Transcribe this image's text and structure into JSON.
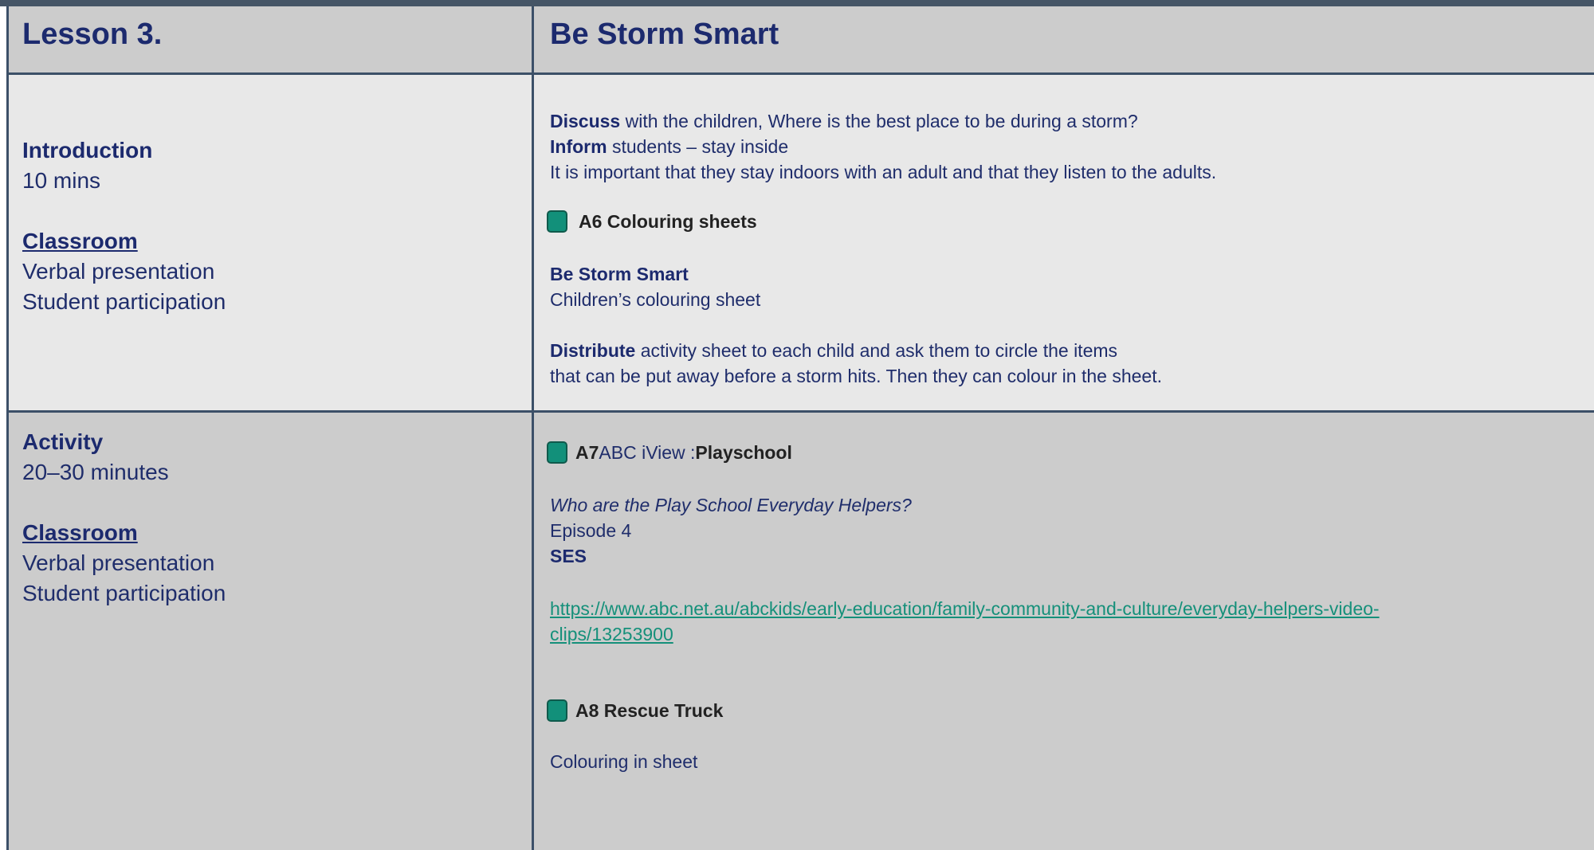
{
  "header": {
    "lesson": "Lesson 3.",
    "title": "Be Storm Smart"
  },
  "intro": {
    "section_title": "Introduction",
    "duration": "10 mins",
    "setting_heading": "Classroom",
    "methods": [
      "Verbal presentation",
      "Student participation"
    ],
    "discuss_kw": "Discuss",
    "discuss_text": " with the children, Where is the best place to be during a storm?",
    "inform_kw": "Inform",
    "inform_text": " students – stay inside",
    "important_text": "It is important that they stay indoors with an adult and that they listen to the adults.",
    "resource_label": "A6 Colouring sheets",
    "sheet_title": "Be Storm Smart",
    "sheet_subtitle": "Children’s colouring sheet",
    "distribute_kw": "Distribute",
    "distribute_text": " activity sheet to each child and ask them to circle the items",
    "distribute_text2": "that can be put away before a storm hits.  Then they can colour in the sheet."
  },
  "activity": {
    "section_title": "Activity",
    "duration": "20–30 minutes",
    "setting_heading": "Classroom",
    "methods": [
      "Verbal presentation",
      "Student participation"
    ],
    "a7_code": "A7",
    "a7_source": " ABC iView : ",
    "a7_show": "Playschool",
    "question": "Who are the Play School Everyday Helpers?",
    "episode": "Episode 4",
    "ses": "SES",
    "url_line1": "https://www.abc.net.au/abckids/early-education/family-community-and-culture/everyday-helpers-video-",
    "url_line2": "clips/13253900",
    "a8_label": "A8 Rescue Truck",
    "a8_desc": "Colouring in sheet"
  },
  "colors": {
    "resource_swatch": "#12907a",
    "link": "#15907a",
    "text_navy": "#1c2a6e",
    "grid_line": "#3c5068"
  }
}
